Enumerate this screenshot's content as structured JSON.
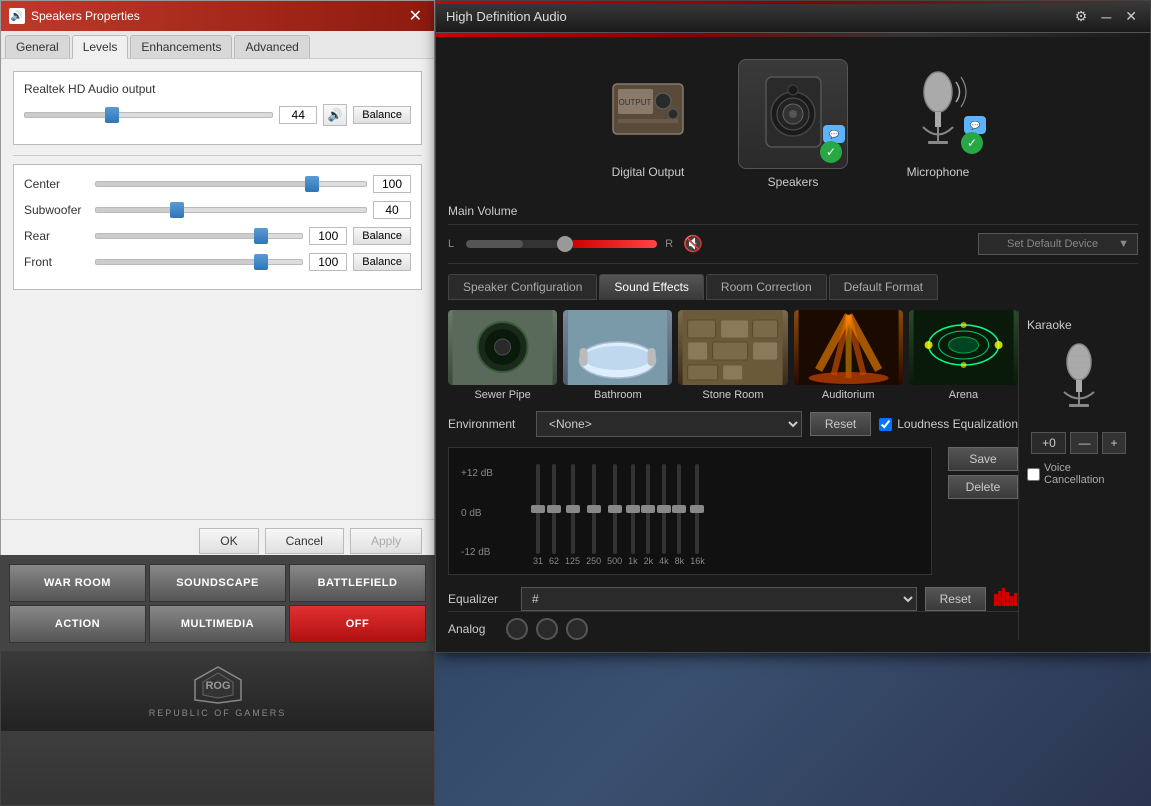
{
  "background": {
    "color": "#2a3a5c"
  },
  "speakers_window": {
    "title": "Speakers Properties",
    "tabs": [
      {
        "id": "general",
        "label": "General"
      },
      {
        "id": "levels",
        "label": "Levels",
        "active": true
      },
      {
        "id": "enhancements",
        "label": "Enhancements"
      },
      {
        "id": "advanced",
        "label": "Advanced"
      }
    ],
    "realtek_section": {
      "label": "Realtek HD Audio output",
      "value": "44",
      "mute_title": "🔊"
    },
    "levels": [
      {
        "label": "Center",
        "value": "100",
        "percent": 80
      },
      {
        "label": "Subwoofer",
        "value": "40",
        "percent": 30
      },
      {
        "label": "Rear",
        "value": "100",
        "percent": 80,
        "has_balance": true
      },
      {
        "label": "Front",
        "value": "100",
        "percent": 80,
        "has_balance": true
      }
    ],
    "footer": {
      "ok": "OK",
      "cancel": "Cancel",
      "apply": "Apply"
    }
  },
  "rog_panel": {
    "buttons": [
      {
        "label": "WAR ROOM",
        "active": false
      },
      {
        "label": "SOUNDSCAPE",
        "active": false
      },
      {
        "label": "BATTLEFIELD",
        "active": false
      },
      {
        "label": "ACTION",
        "active": false
      },
      {
        "label": "MULTIMEDIA",
        "active": false
      },
      {
        "label": "OFF",
        "active": true
      }
    ],
    "logo_text": "REPUBLIC OF\nGAMERS"
  },
  "hda_window": {
    "title": "High Definition Audio",
    "devices": [
      {
        "id": "digital-output",
        "label": "Digital Output",
        "selected": false,
        "has_badge": false
      },
      {
        "id": "speakers",
        "label": "Speakers",
        "selected": true,
        "has_badge": true
      },
      {
        "id": "microphone",
        "label": "Microphone",
        "selected": false,
        "has_badge": true
      }
    ],
    "main_volume": {
      "label": "Main Volume",
      "l_label": "L",
      "r_label": "R",
      "set_default": "Set Default Device"
    },
    "tabs": [
      {
        "id": "speaker-config",
        "label": "Speaker Configuration"
      },
      {
        "id": "sound-effects",
        "label": "Sound Effects",
        "active": true
      },
      {
        "id": "room-correction",
        "label": "Room Correction"
      },
      {
        "id": "default-format",
        "label": "Default Format"
      }
    ],
    "sound_effects": {
      "rooms": [
        {
          "id": "sewer-pipe",
          "label": "Sewer Pipe"
        },
        {
          "id": "bathroom",
          "label": "Bathroom"
        },
        {
          "id": "stone-room",
          "label": "Stone Room"
        },
        {
          "id": "auditorium",
          "label": "Auditorium"
        },
        {
          "id": "arena",
          "label": "Arena"
        }
      ],
      "environment_label": "Environment",
      "environment_value": "<None>",
      "reset_label": "Reset",
      "loudness_label": "Loudness Equalization",
      "loudness_checked": true,
      "eq_db_labels": [
        "+12 dB",
        "0 dB",
        "-12 dB"
      ],
      "eq_freqs": [
        "31",
        "62",
        "125",
        "250",
        "500",
        "1k",
        "2k",
        "4k",
        "8k",
        "16k"
      ],
      "eq_thumb_positions": [
        50,
        50,
        50,
        50,
        50,
        50,
        50,
        50,
        50,
        50
      ],
      "equalizer_label": "Equalizer",
      "equalizer_preset": "#",
      "save_label": "Save",
      "delete_label": "Delete"
    },
    "karaoke": {
      "label": "Karaoke",
      "pitch_value": "+0",
      "minus_label": "—",
      "plus_label": "+",
      "voice_cancel_label": "Voice Cancellation",
      "voice_cancel_checked": false
    },
    "analog": {
      "label": "Analog"
    }
  }
}
